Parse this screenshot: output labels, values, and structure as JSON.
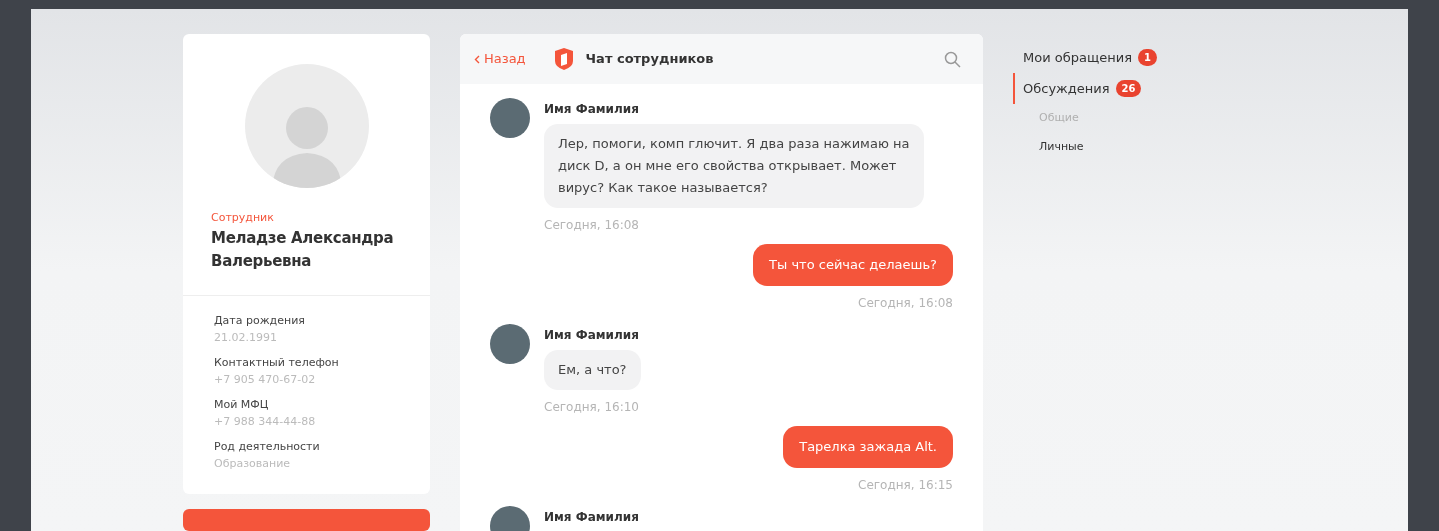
{
  "profile": {
    "role": "Сотрудник",
    "name": "Меладзе Александра Валерьевна",
    "fields": [
      {
        "label": "Дата рождения",
        "value": "21.02.1991"
      },
      {
        "label": "Контактный телефон",
        "value": "+7 905 470-67-02"
      },
      {
        "label": "Мой МФЦ",
        "value": "+7 988 344-44-88"
      },
      {
        "label": "Род деятельности",
        "value": "Образование"
      }
    ]
  },
  "chat": {
    "back": "Назад",
    "title": "Чат сотрудников",
    "messages": [
      {
        "kind": "incoming",
        "author": "Имя Фамилия",
        "text": "Лер, помоги, комп глючит. Я два раза нажимаю на диск D, а он мне его свойства открывает. Может вирус? Как такое называется?",
        "time": "Сегодня, 16:08"
      },
      {
        "kind": "outgoing",
        "text": "Ты что сейчас делаешь?",
        "time": "Сегодня, 16:08"
      },
      {
        "kind": "incoming",
        "author": "Имя Фамилия",
        "text": "Ем, а что?",
        "time": "Сегодня, 16:10"
      },
      {
        "kind": "outgoing",
        "text": "Тарелка зажада Alt.",
        "time": "Сегодня, 16:15"
      },
      {
        "kind": "incoming",
        "author": "Имя Фамилия"
      }
    ]
  },
  "nav": {
    "items": [
      {
        "label": "Мои обращения",
        "badge": "1",
        "selected": false
      },
      {
        "label": "Обсуждения",
        "badge": "26",
        "selected": true,
        "children": [
          {
            "label": "Общие",
            "selected": false
          },
          {
            "label": "Личные",
            "selected": true
          }
        ]
      }
    ]
  }
}
